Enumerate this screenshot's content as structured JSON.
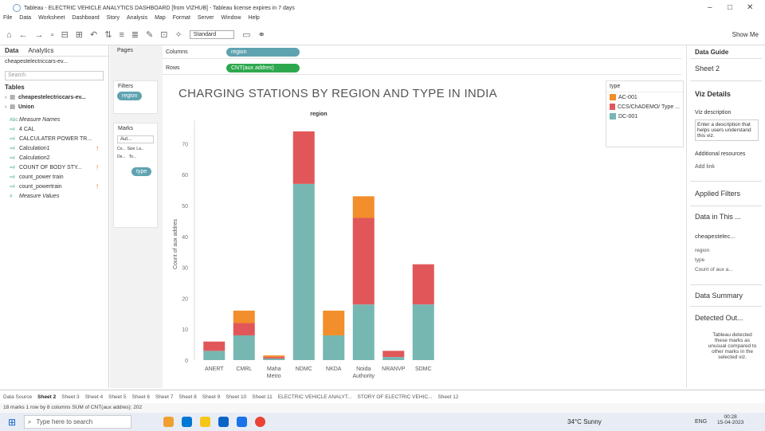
{
  "window": {
    "title": "Tableau - ELECTRIC VEHICLE ANALYTICS DASHBOARD [from VIZHUB] - Tableau license expires in 7 days"
  },
  "menu": [
    "File",
    "Data",
    "Worksheet",
    "Dashboard",
    "Story",
    "Analysis",
    "Map",
    "Format",
    "Server",
    "Window",
    "Help"
  ],
  "toolbar": {
    "fit": "Standard",
    "show_me": "Show Me"
  },
  "datapane": {
    "tab_data": "Data",
    "tab_analytics": "Analytics",
    "datasource": "cheapestelectriccars-ev...",
    "search_placeholder": "Search",
    "tables_label": "Tables",
    "tables": [
      "cheapestelectriccars-ev...",
      "Union"
    ],
    "fields": [
      {
        "type": "Abc",
        "name": "Measure Names",
        "italic": true,
        "warn": ""
      },
      {
        "type": "=#",
        "name": "4 CAL",
        "italic": false,
        "warn": ""
      },
      {
        "type": "=#",
        "name": "CALCULATER POWER TR...",
        "italic": false,
        "warn": ""
      },
      {
        "type": "=#",
        "name": "Calculation1",
        "italic": false,
        "warn": "!"
      },
      {
        "type": "=#",
        "name": "Calculation2",
        "italic": false,
        "warn": ""
      },
      {
        "type": "=#",
        "name": "COUNT OF BODY STY...",
        "italic": false,
        "warn": "!"
      },
      {
        "type": "=#",
        "name": "count_power train",
        "italic": false,
        "warn": ""
      },
      {
        "type": "=#",
        "name": "count_powertrain",
        "italic": false,
        "warn": "!"
      },
      {
        "type": "#",
        "name": "Measure Values",
        "italic": true,
        "warn": ""
      }
    ]
  },
  "cards": {
    "pages": "Pages",
    "filters": "Filters",
    "filter_pill": "region",
    "marks": "Marks",
    "mark_type": "Aut...",
    "color": "Co...",
    "size": "Size",
    "label": "La...",
    "detail": "De...",
    "tooltip": "To...",
    "type_pill": "type"
  },
  "shelves": {
    "columns_label": "Columns",
    "columns_pill": "region",
    "rows_label": "Rows",
    "rows_pill": "CNT(aux addres)"
  },
  "chart_data": {
    "type": "bar",
    "title": "CHARGING STATIONS BY REGION AND TYPE IN INDIA",
    "header": "region",
    "ylabel": "Count of aux addres",
    "ylim": [
      0,
      75
    ],
    "yticks": [
      0,
      10,
      20,
      30,
      40,
      50,
      60,
      70
    ],
    "categories": [
      "ANERT",
      "CMRL",
      "Maha Metro",
      "NDMC",
      "NKDA",
      "Noida Authority",
      "NRANVP",
      "SDMC"
    ],
    "series": [
      {
        "name": "DC-001",
        "color": "#76b7b2",
        "values": [
          3,
          8,
          0.5,
          57,
          8,
          18,
          1,
          18
        ]
      },
      {
        "name": "CCS/CHADEMO/ Type ...",
        "color": "#e15759",
        "values": [
          3,
          4,
          0.5,
          17,
          0,
          28,
          2,
          13
        ]
      },
      {
        "name": "AC-001",
        "color": "#f28e2b",
        "values": [
          0,
          4,
          0.5,
          0,
          8,
          7,
          0,
          0
        ]
      }
    ]
  },
  "legend": {
    "title": "type",
    "items": [
      {
        "label": "AC-001",
        "color": "#f28e2b"
      },
      {
        "label": "CCS/ChADEMO/ Type ...",
        "color": "#e15759"
      },
      {
        "label": "DC-001",
        "color": "#76b7b2"
      }
    ]
  },
  "guide": {
    "title": "Data Guide",
    "sheet": "Sheet 2",
    "viz_details": "Viz Details",
    "viz_desc_label": "Viz description",
    "viz_desc_placeholder": "Enter a description that helps users understand this viz.",
    "resources": "Additional resources",
    "add_link": "Add link",
    "applied_filters": "Applied Filters",
    "data_in_this": "Data in This ...",
    "ds": "cheapestelec...",
    "fields": [
      "region",
      "type",
      "Count of aux a..."
    ],
    "summary": "Data Summary",
    "detected": "Detected Out...",
    "detected_text": "Tableau detected these marks as unusual compared to other marks in the selected viz."
  },
  "sheets": [
    "Data Source",
    "Sheet 2",
    "Sheet 3",
    "Sheet 4",
    "Sheet 5",
    "Sheet 6",
    "Sheet 7",
    "Sheet 8",
    "Sheet 9",
    "Sheet 10",
    "Sheet 11",
    "ELECTRIC VEHICLE ANALYT...",
    "STORY OF ELECTRIC VEHIC...",
    "Sheet 12"
  ],
  "status": "18 marks   1 row by 8 columns   SUM of CNT(aux addres): 202",
  "taskbar": {
    "search": "Type here to search",
    "weather": "34°C  Sunny",
    "lang": "ENG",
    "time": "00:28",
    "date": "15-04-2023"
  }
}
